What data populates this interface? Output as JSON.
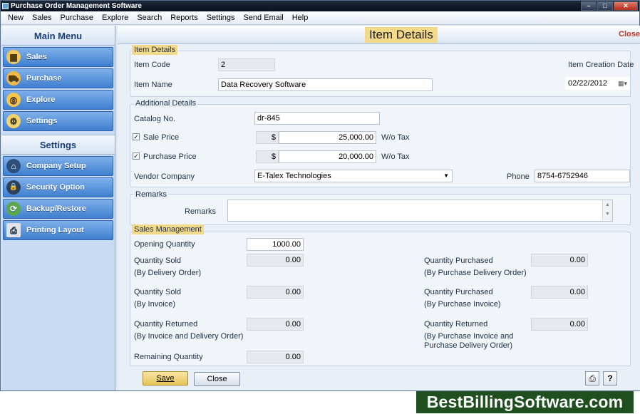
{
  "window": {
    "title": "Purchase Order Management Software",
    "buttons": {
      "minimize": "–",
      "maximize": "□",
      "close": "✕"
    }
  },
  "menu": [
    "New",
    "Sales",
    "Purchase",
    "Explore",
    "Search",
    "Reports",
    "Settings",
    "Send Email",
    "Help"
  ],
  "sidebar": {
    "main_title": "Main Menu",
    "main_items": [
      {
        "label": "Sales",
        "icon": "sales-icon",
        "glyph": "▦"
      },
      {
        "label": "Purchase",
        "icon": "purchase-icon",
        "glyph": "⛟"
      },
      {
        "label": "Explore",
        "icon": "explore-icon",
        "glyph": "◎"
      },
      {
        "label": "Settings",
        "icon": "settings-icon",
        "glyph": "⚙"
      }
    ],
    "settings_title": "Settings",
    "settings_items": [
      {
        "label": "Company Setup",
        "icon": "company-setup-icon",
        "glyph": "⌂"
      },
      {
        "label": "Security Option",
        "icon": "lock-icon",
        "glyph": "🔒"
      },
      {
        "label": "Backup/Restore",
        "icon": "backup-icon",
        "glyph": "⟳"
      },
      {
        "label": "Printing Layout",
        "icon": "printer-icon",
        "glyph": "⎙"
      }
    ]
  },
  "header": {
    "title": "Item Details",
    "close_label": "Close"
  },
  "item_details": {
    "group_label": "Item Details",
    "item_code_label": "Item Code",
    "item_code": "2",
    "item_name_label": "Item Name",
    "item_name": "Data Recovery Software",
    "creation_date_label": "Item Creation Date",
    "creation_date": "02/22/2012"
  },
  "additional": {
    "group_label": "Additional Details",
    "catalog_label": "Catalog No.",
    "catalog": "dr-845",
    "sale_price_label": "Sale Price",
    "sale_price": "25,000.00",
    "purchase_price_label": "Purchase Price",
    "purchase_price": "20,000.00",
    "currency": "$",
    "tax_note": "W/o Tax",
    "vendor_label": "Vendor Company",
    "vendor": "E-Talex Technologies",
    "phone_label": "Phone",
    "phone": "8754-6752946"
  },
  "remarks": {
    "group_label": "Remarks",
    "field_label": "Remarks",
    "value": ""
  },
  "sales_mgmt": {
    "group_label": "Sales Management",
    "opening_qty_label": "Opening Quantity",
    "opening_qty": "1000.00",
    "qty_sold_label": "Quantity Sold",
    "by_delivery_order": "(By Delivery Order)",
    "qty_sold_do": "0.00",
    "by_invoice": "(By Invoice)",
    "qty_sold_inv": "0.00",
    "qty_returned_label": "Quantity Returned",
    "by_inv_and_do": "(By Invoice and Delivery Order)",
    "qty_returned": "0.00",
    "remaining_label": "Remaining Quantity",
    "remaining": "0.00",
    "qty_purchased_label": "Quantity Purchased",
    "by_purchase_do": "(By Purchase Delivery Order)",
    "qty_purchased_do": "0.00",
    "by_purchase_invoice": "(By Purchase Invoice)",
    "qty_purchased_inv": "0.00",
    "by_purchase_inv_and_line1": "(By Purchase Invoice and",
    "by_purchase_inv_and_line2": "Purchase Delivery Order)",
    "qty_purchase_returned": "0.00"
  },
  "footer": {
    "save_label": "Save",
    "close_label": "Close"
  },
  "watermark": "BestBillingSoftware.com"
}
